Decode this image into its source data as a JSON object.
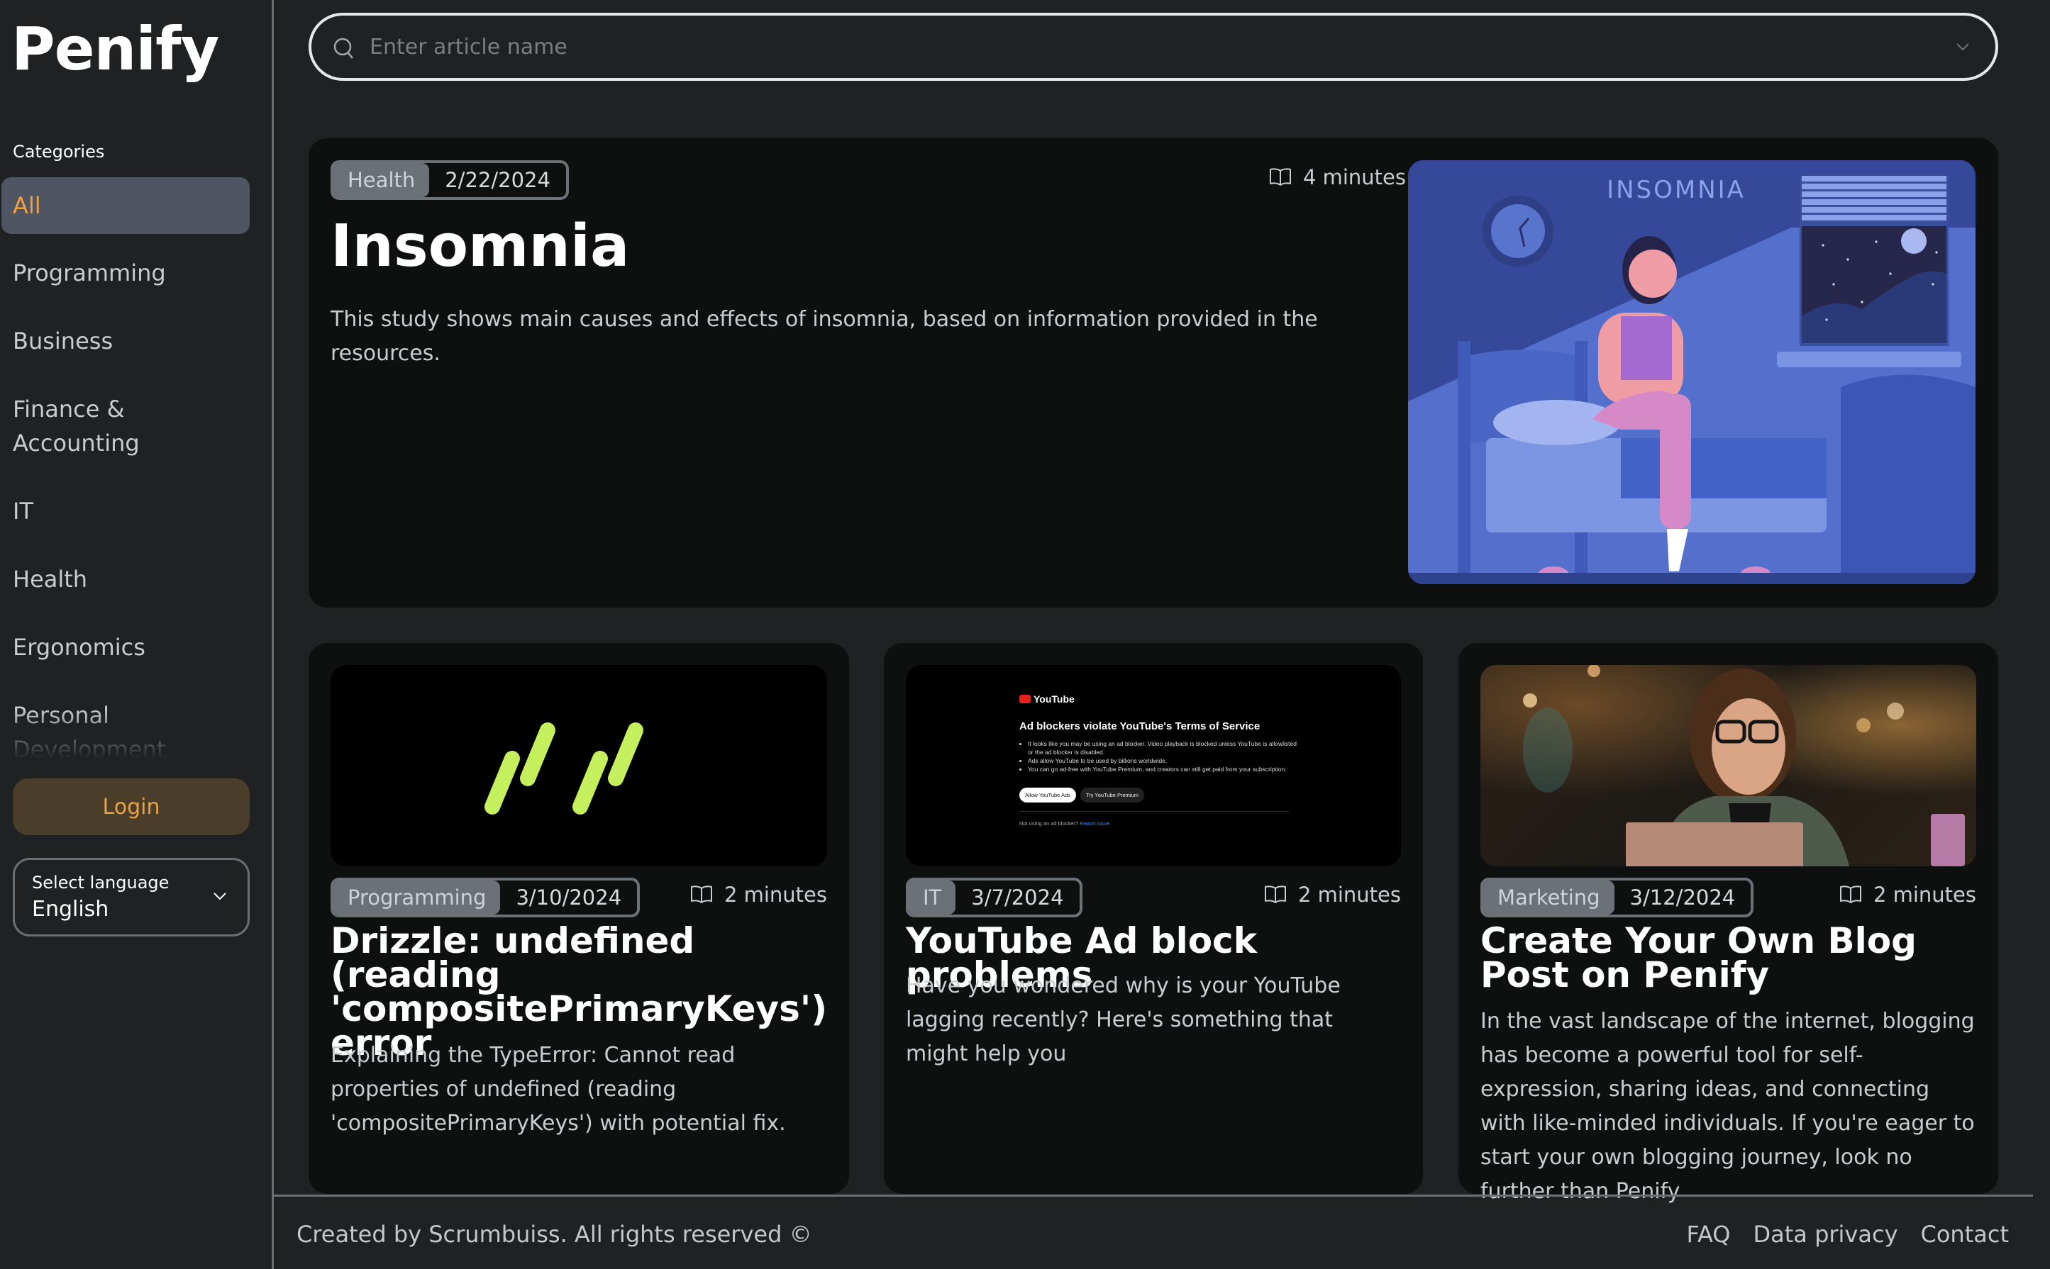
{
  "app": {
    "logo": "Penify"
  },
  "sidebar": {
    "categories_label": "Categories",
    "items": [
      {
        "label": "All",
        "active": true
      },
      {
        "label": "Programming"
      },
      {
        "label": "Business"
      },
      {
        "label": "Finance & Accounting"
      },
      {
        "label": "IT"
      },
      {
        "label": "Health"
      },
      {
        "label": "Ergonomics"
      },
      {
        "label": "Personal Development"
      }
    ],
    "login_label": "Login",
    "language": {
      "label": "Select language",
      "value": "English"
    }
  },
  "search": {
    "placeholder": "Enter article name",
    "value": ""
  },
  "featured": {
    "category": "Health",
    "date": "2/22/2024",
    "read_time": "4 minutes",
    "title": "Insomnia",
    "description": "This study shows main causes and effects of insomnia, based on information provided in the resources.",
    "image_text": "INSOMNIA"
  },
  "articles": [
    {
      "category": "Programming",
      "date": "3/10/2024",
      "read_time": "2 minutes",
      "title": "Drizzle: undefined (reading 'compositePrimaryKeys') error",
      "description": "Explaining the TypeError: Cannot read properties of undefined (reading 'compositePrimaryKeys') with potential fix."
    },
    {
      "category": "IT",
      "date": "3/7/2024",
      "read_time": "2 minutes",
      "title": "YouTube Ad block problems",
      "description": "Have you wondered why is your YouTube lagging recently? Here's something that might help you",
      "image": {
        "brand": "YouTube",
        "heading": "Ad blockers violate YouTube's Terms of Service",
        "bullets": [
          "It looks like you may be using an ad blocker. Video playback is blocked unless YouTube is allowlisted or the ad blocker is disabled.",
          "Ads allow YouTube to be used by billions worldwide.",
          "You can go ad-free with YouTube Premium, and creators can still get paid from your subscription."
        ],
        "btn_allow": "Allow YouTube Ads",
        "btn_premium": "Try YouTube Premium",
        "footer_text": "Not using an ad blocker?",
        "footer_link": "Report issue"
      }
    },
    {
      "category": "Marketing",
      "date": "3/12/2024",
      "read_time": "2 minutes",
      "title": "Create Your Own Blog Post on Penify",
      "description": "In the vast landscape of the internet, blogging has become a powerful tool for self-expression, sharing ideas, and connecting with like-minded individuals. If you're eager to start your own blogging journey, look no further than Penify"
    }
  ],
  "footer": {
    "copyright": "Created by Scrumbuiss. All rights reserved ©",
    "links": [
      "FAQ",
      "Data privacy",
      "Contact"
    ]
  },
  "colors": {
    "accent": "#eba342",
    "background": "#1f2123",
    "card": "#0e100f",
    "active_item": "#4f5563",
    "chip": "#6b7176",
    "drizzle_green": "#c5f05e"
  }
}
